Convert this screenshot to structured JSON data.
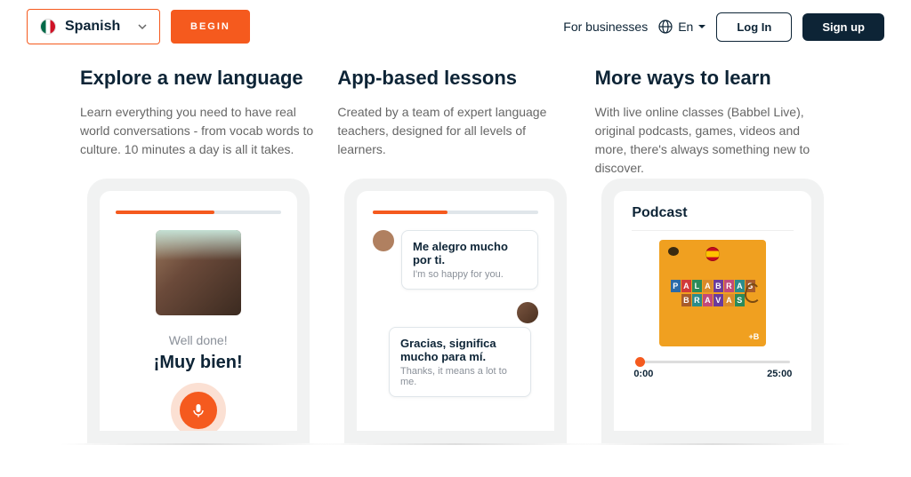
{
  "header": {
    "language": "Spanish",
    "begin": "BEGIN",
    "for_businesses": "For businesses",
    "en_label": "En",
    "login": "Log In",
    "signup": "Sign up"
  },
  "cols": [
    {
      "title": "Explore a new language",
      "desc": "Learn everything you need to have real world conversations - from vocab words to culture. 10 minutes a day is all it takes."
    },
    {
      "title": "App-based lessons",
      "desc": "Created by a team of expert language teachers, designed for all levels of learners."
    },
    {
      "title": "More ways to learn",
      "desc": "With live online classes (Babbel Live), original podcasts, games, videos and more, there's always something new to discover."
    }
  ],
  "phone1": {
    "welldone": "Well done!",
    "muybien": "¡Muy bien!"
  },
  "phone2": {
    "msg1": "Me alegro mucho por ti.",
    "msg1_tr": "I'm so happy for you.",
    "msg2": "Gracias, significa mucho para mí.",
    "msg2_tr": "Thanks, it means a lot to me."
  },
  "phone3": {
    "podcast": "Podcast",
    "art_line1": "PALABRAS",
    "art_line2": "BRAVAS",
    "plus_b": "+B",
    "start": "0:00",
    "end": "25:00"
  },
  "tile_colors": [
    "#2b6aa8",
    "#d13a3a",
    "#2b8a5a",
    "#d98a2b",
    "#6a3b9c",
    "#c24a7a",
    "#2b8c8c",
    "#a85b2b"
  ]
}
